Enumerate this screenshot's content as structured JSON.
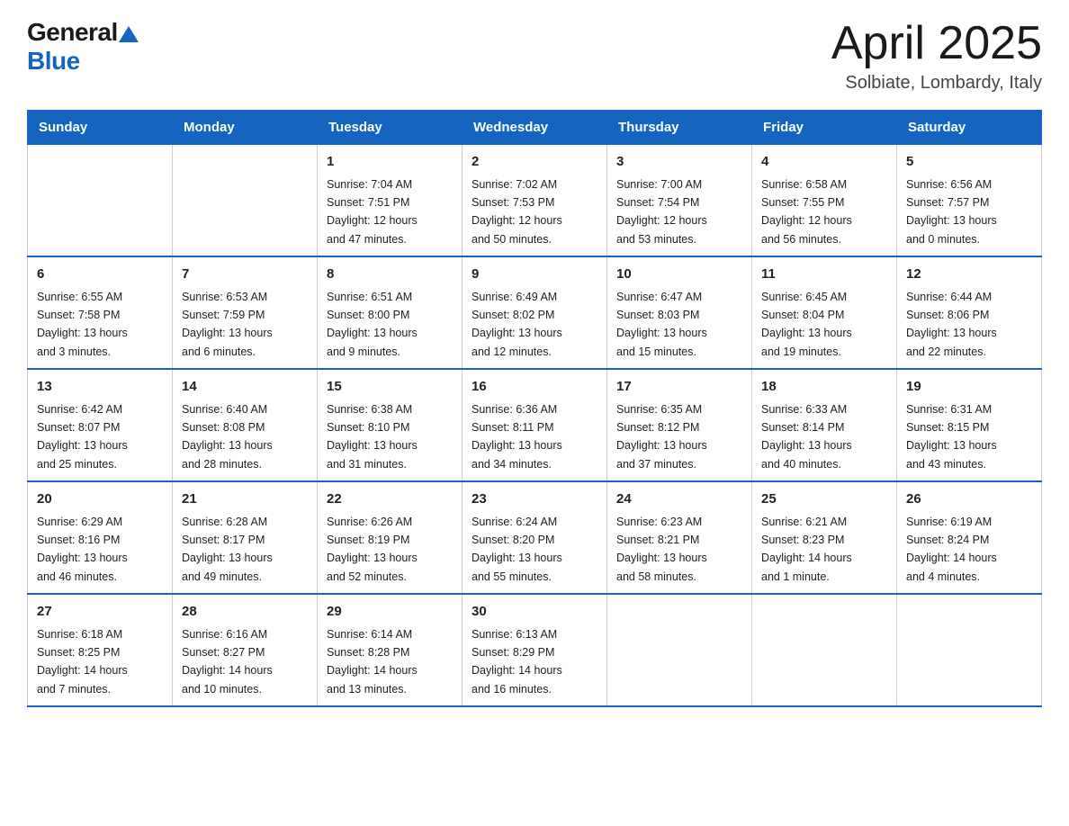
{
  "header": {
    "logo_general": "General",
    "logo_blue": "Blue",
    "title": "April 2025",
    "subtitle": "Solbiate, Lombardy, Italy"
  },
  "days_of_week": [
    "Sunday",
    "Monday",
    "Tuesday",
    "Wednesday",
    "Thursday",
    "Friday",
    "Saturday"
  ],
  "weeks": [
    [
      {
        "day": "",
        "info": ""
      },
      {
        "day": "",
        "info": ""
      },
      {
        "day": "1",
        "info": "Sunrise: 7:04 AM\nSunset: 7:51 PM\nDaylight: 12 hours\nand 47 minutes."
      },
      {
        "day": "2",
        "info": "Sunrise: 7:02 AM\nSunset: 7:53 PM\nDaylight: 12 hours\nand 50 minutes."
      },
      {
        "day": "3",
        "info": "Sunrise: 7:00 AM\nSunset: 7:54 PM\nDaylight: 12 hours\nand 53 minutes."
      },
      {
        "day": "4",
        "info": "Sunrise: 6:58 AM\nSunset: 7:55 PM\nDaylight: 12 hours\nand 56 minutes."
      },
      {
        "day": "5",
        "info": "Sunrise: 6:56 AM\nSunset: 7:57 PM\nDaylight: 13 hours\nand 0 minutes."
      }
    ],
    [
      {
        "day": "6",
        "info": "Sunrise: 6:55 AM\nSunset: 7:58 PM\nDaylight: 13 hours\nand 3 minutes."
      },
      {
        "day": "7",
        "info": "Sunrise: 6:53 AM\nSunset: 7:59 PM\nDaylight: 13 hours\nand 6 minutes."
      },
      {
        "day": "8",
        "info": "Sunrise: 6:51 AM\nSunset: 8:00 PM\nDaylight: 13 hours\nand 9 minutes."
      },
      {
        "day": "9",
        "info": "Sunrise: 6:49 AM\nSunset: 8:02 PM\nDaylight: 13 hours\nand 12 minutes."
      },
      {
        "day": "10",
        "info": "Sunrise: 6:47 AM\nSunset: 8:03 PM\nDaylight: 13 hours\nand 15 minutes."
      },
      {
        "day": "11",
        "info": "Sunrise: 6:45 AM\nSunset: 8:04 PM\nDaylight: 13 hours\nand 19 minutes."
      },
      {
        "day": "12",
        "info": "Sunrise: 6:44 AM\nSunset: 8:06 PM\nDaylight: 13 hours\nand 22 minutes."
      }
    ],
    [
      {
        "day": "13",
        "info": "Sunrise: 6:42 AM\nSunset: 8:07 PM\nDaylight: 13 hours\nand 25 minutes."
      },
      {
        "day": "14",
        "info": "Sunrise: 6:40 AM\nSunset: 8:08 PM\nDaylight: 13 hours\nand 28 minutes."
      },
      {
        "day": "15",
        "info": "Sunrise: 6:38 AM\nSunset: 8:10 PM\nDaylight: 13 hours\nand 31 minutes."
      },
      {
        "day": "16",
        "info": "Sunrise: 6:36 AM\nSunset: 8:11 PM\nDaylight: 13 hours\nand 34 minutes."
      },
      {
        "day": "17",
        "info": "Sunrise: 6:35 AM\nSunset: 8:12 PM\nDaylight: 13 hours\nand 37 minutes."
      },
      {
        "day": "18",
        "info": "Sunrise: 6:33 AM\nSunset: 8:14 PM\nDaylight: 13 hours\nand 40 minutes."
      },
      {
        "day": "19",
        "info": "Sunrise: 6:31 AM\nSunset: 8:15 PM\nDaylight: 13 hours\nand 43 minutes."
      }
    ],
    [
      {
        "day": "20",
        "info": "Sunrise: 6:29 AM\nSunset: 8:16 PM\nDaylight: 13 hours\nand 46 minutes."
      },
      {
        "day": "21",
        "info": "Sunrise: 6:28 AM\nSunset: 8:17 PM\nDaylight: 13 hours\nand 49 minutes."
      },
      {
        "day": "22",
        "info": "Sunrise: 6:26 AM\nSunset: 8:19 PM\nDaylight: 13 hours\nand 52 minutes."
      },
      {
        "day": "23",
        "info": "Sunrise: 6:24 AM\nSunset: 8:20 PM\nDaylight: 13 hours\nand 55 minutes."
      },
      {
        "day": "24",
        "info": "Sunrise: 6:23 AM\nSunset: 8:21 PM\nDaylight: 13 hours\nand 58 minutes."
      },
      {
        "day": "25",
        "info": "Sunrise: 6:21 AM\nSunset: 8:23 PM\nDaylight: 14 hours\nand 1 minute."
      },
      {
        "day": "26",
        "info": "Sunrise: 6:19 AM\nSunset: 8:24 PM\nDaylight: 14 hours\nand 4 minutes."
      }
    ],
    [
      {
        "day": "27",
        "info": "Sunrise: 6:18 AM\nSunset: 8:25 PM\nDaylight: 14 hours\nand 7 minutes."
      },
      {
        "day": "28",
        "info": "Sunrise: 6:16 AM\nSunset: 8:27 PM\nDaylight: 14 hours\nand 10 minutes."
      },
      {
        "day": "29",
        "info": "Sunrise: 6:14 AM\nSunset: 8:28 PM\nDaylight: 14 hours\nand 13 minutes."
      },
      {
        "day": "30",
        "info": "Sunrise: 6:13 AM\nSunset: 8:29 PM\nDaylight: 14 hours\nand 16 minutes."
      },
      {
        "day": "",
        "info": ""
      },
      {
        "day": "",
        "info": ""
      },
      {
        "day": "",
        "info": ""
      }
    ]
  ]
}
